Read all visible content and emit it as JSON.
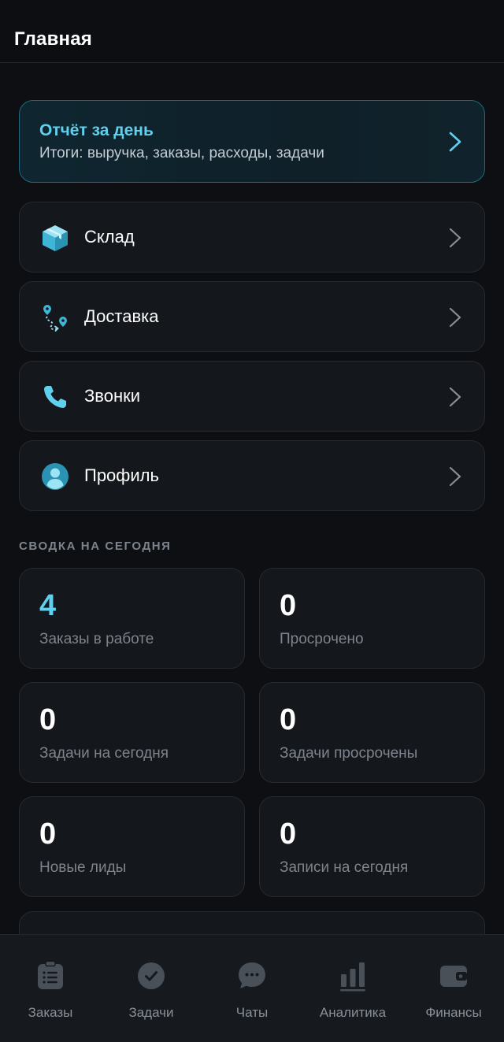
{
  "header": {
    "title": "Главная"
  },
  "report": {
    "title": "Отчёт за день",
    "subtitle": "Итоги: выручка, заказы, расходы, задачи",
    "icon": "chevron-right-icon"
  },
  "nav": [
    {
      "label": "Склад",
      "icon": "box-icon"
    },
    {
      "label": "Доставка",
      "icon": "route-icon"
    },
    {
      "label": "Звонки",
      "icon": "phone-icon"
    },
    {
      "label": "Профиль",
      "icon": "user-icon"
    }
  ],
  "summary": {
    "section_label": "СВОДКА НА СЕГОДНЯ",
    "stats": [
      {
        "value": "4",
        "label": "Заказы в работе"
      },
      {
        "value": "0",
        "label": "Просрочено"
      },
      {
        "value": "0",
        "label": "Задачи на сегодня"
      },
      {
        "value": "0",
        "label": "Задачи просрочены"
      },
      {
        "value": "0",
        "label": "Новые лиды"
      },
      {
        "value": "0",
        "label": "Записи на сегодня"
      }
    ]
  },
  "tabs": [
    {
      "label": "Заказы",
      "icon": "orders-icon"
    },
    {
      "label": "Задачи",
      "icon": "check-circle-icon"
    },
    {
      "label": "Чаты",
      "icon": "chat-icon"
    },
    {
      "label": "Аналитика",
      "icon": "bar-chart-icon"
    },
    {
      "label": "Финансы",
      "icon": "wallet-icon"
    }
  ],
  "colors": {
    "accent": "#5fd0ee",
    "background": "#0d0f12",
    "card": "#14171b",
    "muted_text": "#7d848d"
  }
}
